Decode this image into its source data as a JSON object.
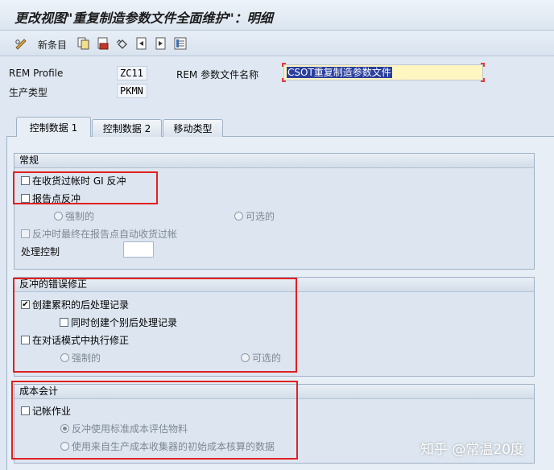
{
  "title": "更改视图\"重复制造参数文件全面维护\"：明细",
  "toolbar": {
    "new_entries_label": "新条目",
    "icons": [
      "edit-glasses-icon",
      "copy-icon",
      "delete-icon",
      "undo-icon",
      "prev-entry-icon",
      "next-entry-icon",
      "select-all-icon"
    ]
  },
  "header_fields": {
    "rem_profile_label": "REM Profile",
    "rem_profile_value": "ZC11",
    "production_type_label": "生产类型",
    "production_type_value": "PKMN",
    "profile_name_label": "REM 参数文件名称",
    "profile_name_value": "CSOT重复制造参数文件"
  },
  "tabs": [
    {
      "label": "控制数据 1",
      "active": true
    },
    {
      "label": "控制数据 2",
      "active": false
    },
    {
      "label": "移动类型",
      "active": false
    }
  ],
  "general": {
    "header": "常规",
    "gi_reverse_label": "在收货过帐时 GI 反冲",
    "reporting_point_label": "报告点反冲",
    "mandatory_label": "强制的",
    "optional_label": "可选的",
    "auto_gr_label": "反冲时最终在报告点自动收货过帐",
    "process_control_label": "处理控制",
    "process_control_value": ""
  },
  "backflush_errors": {
    "header": "反冲的错误修正",
    "create_cumulative_label": "创建累积的后处理记录",
    "create_individual_label": "同时创建个别后处理记录",
    "dialog_mode_label": "在对话模式中执行修正",
    "mandatory_label": "强制的",
    "optional_label": "可选的",
    "create_cumulative_checked": true
  },
  "costing": {
    "header": "成本会计",
    "post_activity_label": "记帐作业",
    "std_cost_label": "反冲使用标准成本评估物料",
    "collector_label": "使用来自生产成本收集器的初始成本核算的数据"
  },
  "watermark": "知乎 @常温20度",
  "colors": {
    "highlight_border": "#e02020",
    "input_yellow": "#fff6c2",
    "selection": "#2a3f9e"
  }
}
